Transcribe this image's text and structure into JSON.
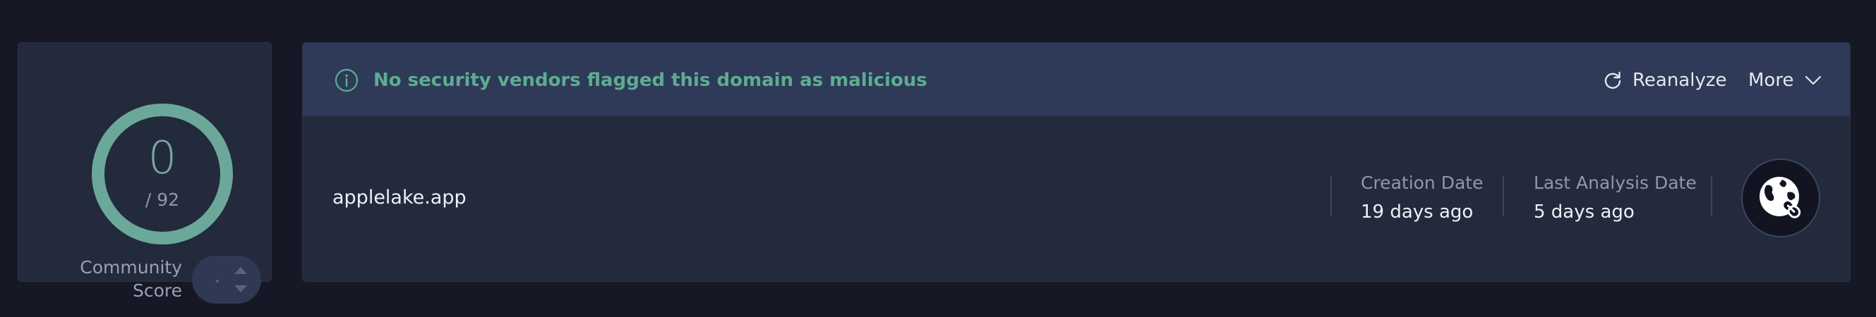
{
  "score": {
    "value": "0",
    "total": "/ 92",
    "ring_color": "#6ba89a"
  },
  "community": {
    "label": "Community Score"
  },
  "alert": {
    "message": "No security vendors flagged this domain as malicious",
    "color": "#5dac93",
    "icon": "info-circle-icon"
  },
  "actions": {
    "reanalyze_label": "Reanalyze",
    "reanalyze_icon": "refresh-icon",
    "more_label": "More",
    "more_icon": "chevron-down-icon"
  },
  "domain": {
    "name": "applelake.app",
    "creation_label": "Creation Date",
    "creation_value": "19 days ago",
    "analysis_label": "Last Analysis Date",
    "analysis_value": "5 days ago",
    "type_icon": "globe-link-icon"
  }
}
